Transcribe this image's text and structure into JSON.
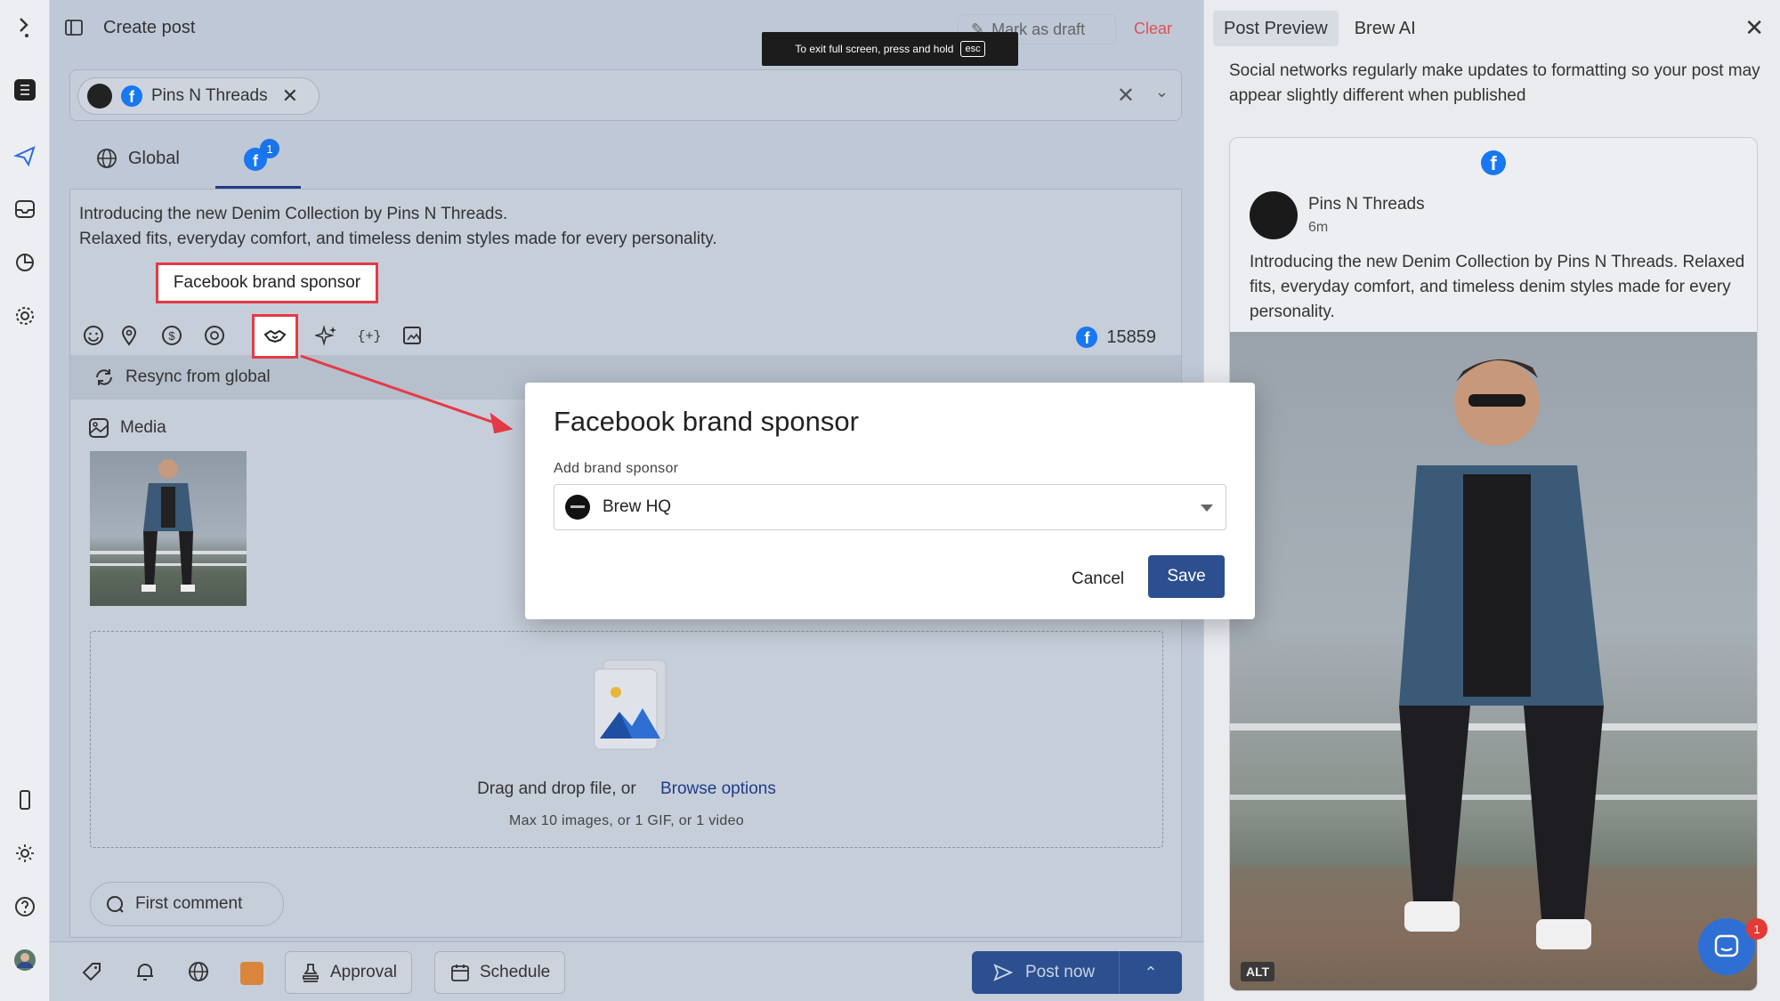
{
  "topbar": {
    "title": "Create post",
    "mark_draft": "Mark as draft",
    "clear": "Clear"
  },
  "fullscreen_toast": {
    "text": "To exit full screen, press and hold",
    "key": "esc"
  },
  "accounts": {
    "chip_label": "Pins N Threads"
  },
  "tabs": {
    "global": "Global",
    "facebook_badge": "1"
  },
  "post": {
    "line1": "Introducing the new Denim Collection by Pins N Threads.",
    "line2": "Relaxed fits, everyday comfort, and timeless denim styles made for every personality.",
    "char_count": "15859"
  },
  "tooltip": {
    "label": "Facebook brand sponsor"
  },
  "resync": {
    "label": "Resync from global"
  },
  "media": {
    "label": "Media",
    "drop_text": "Drag and drop file, or",
    "browse": "Browse options",
    "limits": "Max 10 images, or 1 GIF, or 1 video"
  },
  "first_comment": {
    "label": "First comment"
  },
  "bottombar": {
    "approval": "Approval",
    "schedule": "Schedule",
    "post_now": "Post now",
    "swatch_color": "#d9853b"
  },
  "modal": {
    "title": "Facebook brand sponsor",
    "field_label": "Add brand sponsor",
    "selected": "Brew HQ",
    "cancel": "Cancel",
    "save": "Save"
  },
  "preview": {
    "tab_preview": "Post Preview",
    "tab_ai": "Brew AI",
    "note": "Social networks regularly make updates to formatting so your post may appear slightly different when published",
    "account_name": "Pins N Threads",
    "time": "6m",
    "text": "Introducing the new Denim Collection by Pins N Threads. Relaxed fits, everyday comfort, and timeless denim styles made for every personality.",
    "alt_badge": "ALT"
  },
  "chat": {
    "badge": "1"
  },
  "colors": {
    "accent": "#2c4f8f",
    "facebook": "#1877f2",
    "highlight": "#e63946",
    "clear": "#d9534f"
  }
}
